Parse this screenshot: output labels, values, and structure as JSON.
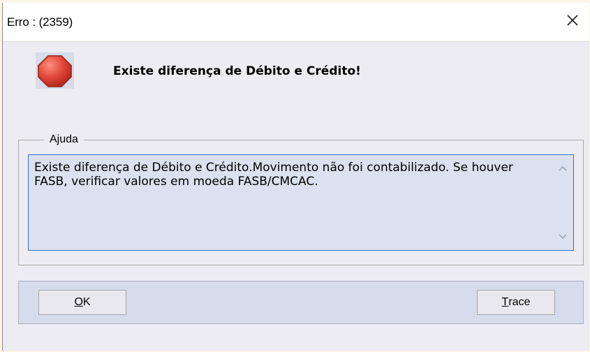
{
  "window": {
    "title": "Erro : (2359)"
  },
  "icons": {
    "status": "stop-icon",
    "close": "close-icon",
    "scroll_up": "scroll-up-icon",
    "scroll_down": "scroll-down-icon"
  },
  "message": {
    "headline": "Existe diferença de Débito e Crédito!"
  },
  "help": {
    "legend": "Ajuda",
    "text": "Existe diferença de Débito e Crédito.Movimento não foi contabilizado. Se houver FASB, verificar valores em moeda FASB/CMCAC."
  },
  "buttons": {
    "ok": {
      "mnemonic": "O",
      "rest": "K"
    },
    "trace": {
      "mnemonic": "T",
      "rest": "race"
    }
  },
  "colors": {
    "page_bg": "#fbf6e8",
    "dialog_bg": "#ececf2",
    "icon_bg": "#d7dbea",
    "stop_red": "#e44b3c",
    "focus_border": "#2f6fd3",
    "button_bar_bg": "#d7dcec"
  }
}
